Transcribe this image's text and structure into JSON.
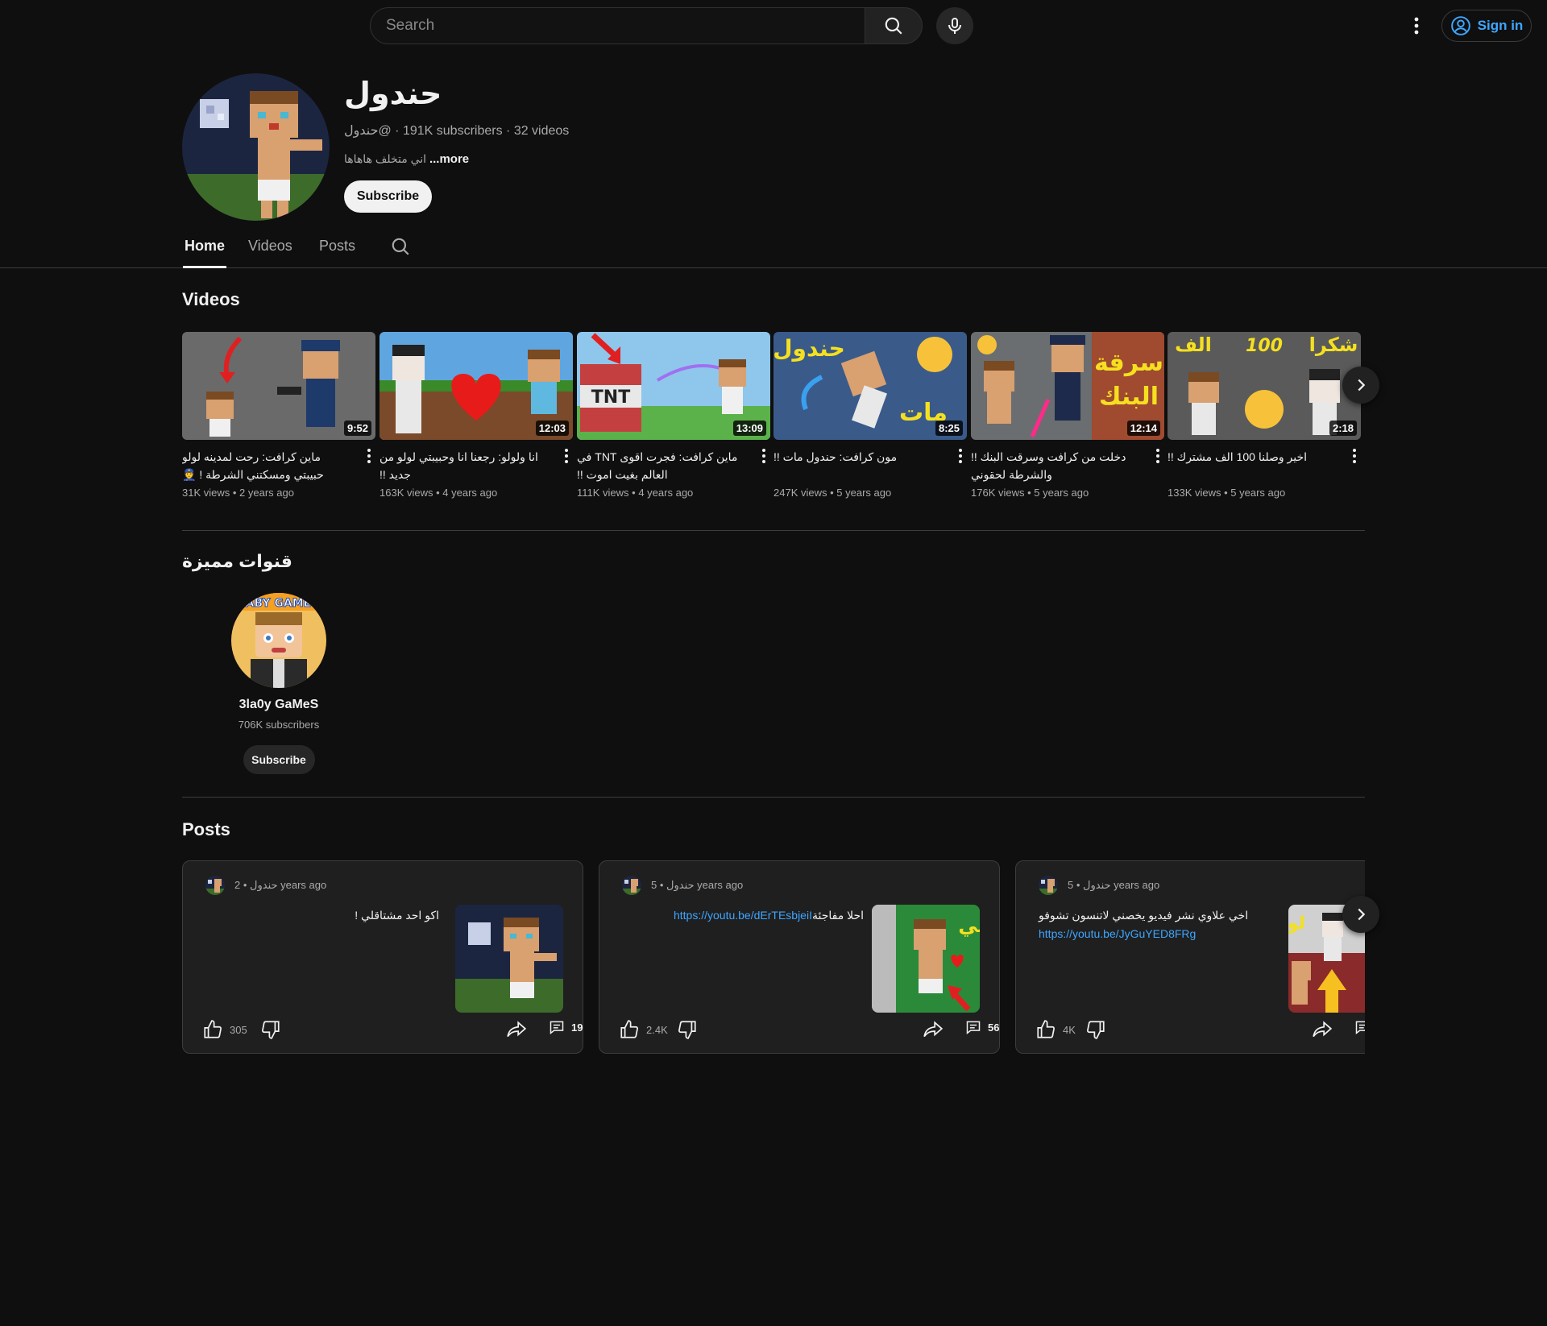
{
  "header": {
    "search_placeholder": "Search",
    "signin_label": "Sign in"
  },
  "channel": {
    "name": "حندول",
    "handle": "@حندول",
    "subscribers": "191K subscribers",
    "videos_count": "32 videos",
    "description": "اني متخلف هاهاها",
    "more_label": "...more",
    "subscribe_label": "Subscribe"
  },
  "tabs": [
    {
      "label": "Home",
      "active": true
    },
    {
      "label": "Videos",
      "active": false
    },
    {
      "label": "Posts",
      "active": false
    }
  ],
  "videos_section": {
    "title": "Videos",
    "items": [
      {
        "title": "ماين كرافت: رحت لمدينه لولو حبيبتي ومسكتني الشرطة ! 👮",
        "views": "31K views",
        "age": "2 years ago",
        "duration": "9:52"
      },
      {
        "title": "انا ولولو: رجعنا انا وحبيبتي لولو من جديد !!",
        "views": "163K views",
        "age": "4 years ago",
        "duration": "12:03"
      },
      {
        "title": "ماين كرافت: فجرت اقوى TNT في العالم بغيت اموت !!",
        "views": "111K views",
        "age": "4 years ago",
        "duration": "13:09"
      },
      {
        "title": "مون كرافت: حندول مات !!",
        "views": "247K views",
        "age": "5 years ago",
        "duration": "8:25"
      },
      {
        "title": "دخلت من كرافت وسرقت البنك !! والشرطة لحقوني",
        "views": "176K views",
        "age": "5 years ago",
        "duration": "12:14"
      },
      {
        "title": "اخير وصلنا 100 الف مشترك !!",
        "views": "133K views",
        "age": "5 years ago",
        "duration": "2:18"
      }
    ]
  },
  "featured_section": {
    "title": "قنوات مميزة",
    "channel_name": "3la0y GaMeS",
    "subscribers": "706K subscribers",
    "subscribe_label": "Subscribe",
    "avatar_banner": "LABY GAMES"
  },
  "posts_section": {
    "title": "Posts",
    "items": [
      {
        "author": "حندول",
        "age": "2 years ago",
        "text": "اكو احد مشتاقلي !",
        "link": "",
        "likes": "305",
        "comments": "19"
      },
      {
        "author": "حندول",
        "age": "5 years ago",
        "text": "احلا مفاجئة",
        "link": "https://youtu.be/dErTEsbjeiI",
        "likes": "2.4K",
        "comments": "56"
      },
      {
        "author": "حندول",
        "age": "5 years ago",
        "text": "اخي علاوي نشر فيديو يخصني لاتنسون تشوفو",
        "link": "https://youtu.be/JyGuYED8FRg",
        "likes": "4K",
        "comments": ""
      }
    ]
  },
  "thumb_texts": {
    "tnt": "TNT",
    "handol": "حندول",
    "mat": "مات",
    "bank1": "سرقة",
    "bank2": "البنك",
    "alf": "الف",
    "hundred": "100",
    "shukran": "شكرا",
    "post2_side": "لي",
    "post3_side": "لو"
  },
  "colors": {
    "background": "#0f0f0f",
    "link": "#3ea6ff",
    "secondary_text": "#aaaaaa"
  }
}
